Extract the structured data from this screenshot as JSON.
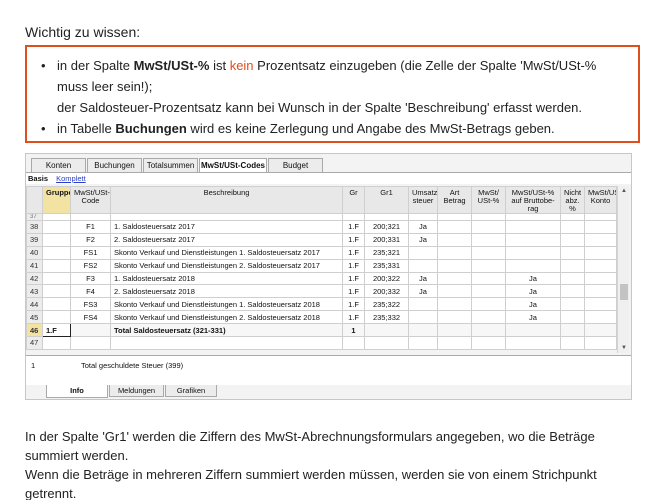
{
  "heading": "Wichtig zu wissen:",
  "note": {
    "b1_a": "in der Spalte ",
    "b1_b": "MwSt/USt-%",
    "b1_c": " ist ",
    "b1_d": "kein",
    "b1_e": " Prozentsatz einzugeben (die Zelle der Spalte 'MwSt/USt-% muss leer sein!);",
    "b1_f": "der Saldosteuer-Prozentsatz kann bei Wunsch in der Spalte 'Beschreibung' erfasst werden.",
    "b2_a": "in Tabelle ",
    "b2_b": "Buchungen",
    "b2_c": " wird es keine Zerlegung und Angabe des MwSt-Betrags geben."
  },
  "tabs": [
    "Konten",
    "Buchungen",
    "Totalsummen",
    "MwSt/USt-Codes",
    "Budget"
  ],
  "modes": {
    "basis": "Basis",
    "komplett": "Komplett"
  },
  "columns": [
    "Gruppe",
    "MwSt/USt-Code",
    "Beschreibung",
    "Gr",
    "Gr1",
    "Umsatz-steuer",
    "Art Betrag",
    "MwSt/ USt-%",
    "MwSt/USt-% auf Bruttobe-rag",
    "Nicht abz. %",
    "MwSt/USt-Konto"
  ],
  "partial_row": "37",
  "rows": [
    {
      "rn": "38",
      "code": "F1",
      "desc": "1. Saldosteuersatz 2017",
      "gr": "1.F",
      "gr1": "200;321",
      "ust": "Ja",
      "brutto": ""
    },
    {
      "rn": "39",
      "code": "F2",
      "desc": "2. Saldosteuersatz 2017",
      "gr": "1.F",
      "gr1": "200;331",
      "ust": "Ja",
      "brutto": ""
    },
    {
      "rn": "40",
      "code": "FS1",
      "desc": "Skonto Verkauf und Dienstleistungen 1. Saldosteuersatz 2017",
      "gr": "1.F",
      "gr1": "235;321",
      "ust": "",
      "brutto": ""
    },
    {
      "rn": "41",
      "code": "FS2",
      "desc": "Skonto Verkauf und Dienstleistungen 2. Saldosteuersatz 2017",
      "gr": "1.F",
      "gr1": "235;331",
      "ust": "",
      "brutto": ""
    },
    {
      "rn": "42",
      "code": "F3",
      "desc": "1. Saldosteuersatz 2018",
      "gr": "1.F",
      "gr1": "200;322",
      "ust": "Ja",
      "brutto": "Ja"
    },
    {
      "rn": "43",
      "code": "F4",
      "desc": "2. Saldosteuersatz 2018",
      "gr": "1.F",
      "gr1": "200;332",
      "ust": "Ja",
      "brutto": "Ja"
    },
    {
      "rn": "44",
      "code": "FS3",
      "desc": "Skonto Verkauf und Dienstleistungen 1. Saldosteuersatz 2018",
      "gr": "1.F",
      "gr1": "235;322",
      "ust": "",
      "brutto": "Ja"
    },
    {
      "rn": "45",
      "code": "FS4",
      "desc": "Skonto Verkauf und Dienstleistungen 2. Saldosteuersatz 2018",
      "gr": "1.F",
      "gr1": "235;332",
      "ust": "",
      "brutto": "Ja"
    }
  ],
  "total_row": {
    "rn": "46",
    "gruppe": "1.F",
    "desc": "Total Saldosteuersatz (321-331)",
    "gr": "1"
  },
  "empty_row": "47",
  "info": {
    "num": "1",
    "text": "Total geschuldete Steuer (399)"
  },
  "bottom_tabs": [
    "Info",
    "Meldungen",
    "Grafiken"
  ],
  "para1": "In der Spalte 'Gr1' werden die Ziffern des MwSt-Abrechnungsformulars angegeben, wo die Beträge summiert werden.",
  "para2": "Wenn die Beträge in mehreren Ziffern summiert werden müssen, werden sie von einem Strichpunkt getrennt."
}
